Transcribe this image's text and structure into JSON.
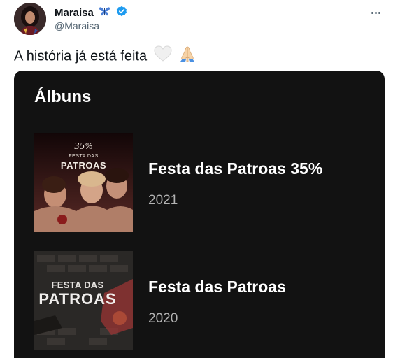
{
  "tweet": {
    "author": {
      "display_name": "Maraisa",
      "handle": "@Maraisa",
      "name_emoji": "butterfly-icon",
      "verified_icon": "verified-badge-icon",
      "avatar": "avatar-photo"
    },
    "text": "A história já está feita",
    "text_emojis": [
      "white-heart-icon",
      "folded-hands-icon"
    ],
    "more_icon": "more-options-icon"
  },
  "card": {
    "title": "Álbuns",
    "albums": [
      {
        "name": "Festa das Patroas 35%",
        "year": "2021",
        "cover_text_top": "35%",
        "cover_text_line1": "FESTA DAS",
        "cover_text_line2": "PATROAS"
      },
      {
        "name": "Festa das Patroas",
        "year": "2020",
        "cover_text_line1": "FESTA DAS",
        "cover_text_line2": "PATROAS"
      }
    ]
  },
  "colors": {
    "card_bg": "#121212",
    "accent_blue": "#1d9bf0",
    "muted_text": "#536471",
    "year_text": "#b3b3b3"
  }
}
